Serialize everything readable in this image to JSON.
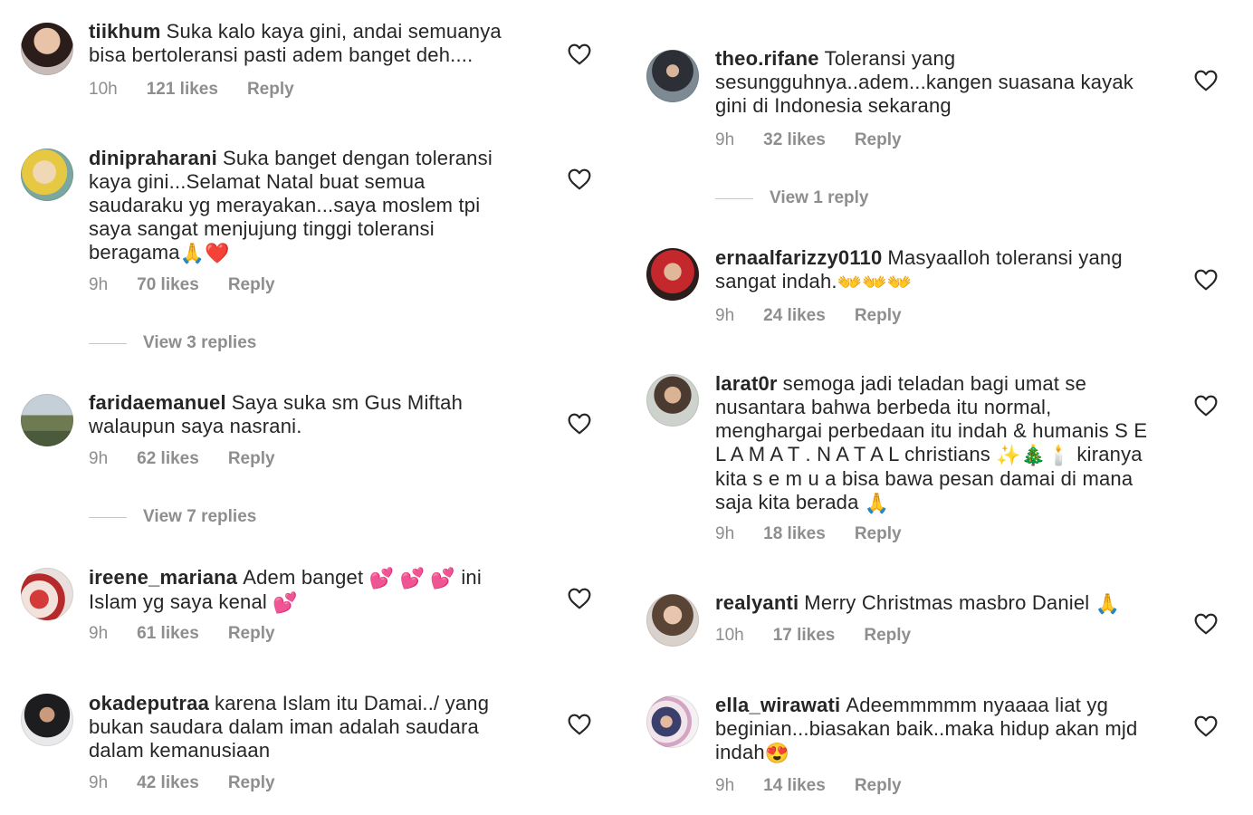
{
  "left": {
    "comments": [
      {
        "username": "tiikhum",
        "text": "Suka kalo kaya gini, andai semuanya bisa bertoleransi pasti adem banget deh....",
        "time": "10h",
        "likes": "121 likes",
        "reply": "Reply"
      },
      {
        "username": "dinipraharani",
        "text": "Suka banget dengan toleransi kaya gini...Selamat Natal buat semua saudaraku yg merayakan...saya moslem tpi saya sangat menjujung tinggi toleransi beragama",
        "emoji": "🙏❤️",
        "time": "9h",
        "likes": "70 likes",
        "reply": "Reply",
        "view_replies": "View 3 replies"
      },
      {
        "username": "faridaemanuel",
        "text": "Saya suka sm Gus Miftah walaupun saya nasrani.",
        "time": "9h",
        "likes": "62 likes",
        "reply": "Reply",
        "view_replies": "View 7 replies"
      },
      {
        "username": "ireene_mariana",
        "text_a": "Adem banget",
        "emoji_a": "💕 💕 💕",
        "text_b": "ini Islam yg saya kenal",
        "emoji_b": "💕",
        "time": "9h",
        "likes": "61 likes",
        "reply": "Reply"
      },
      {
        "username": "okadeputraa",
        "text": "karena Islam itu Damai../ yang bukan saudara dalam iman adalah saudara dalam kemanusiaan",
        "time": "9h",
        "likes": "42 likes",
        "reply": "Reply"
      }
    ]
  },
  "right": {
    "comments": [
      {
        "username": "theo.rifane",
        "text": "Toleransi yang sesungguhnya..adem...kangen suasana kayak gini di Indonesia sekarang",
        "time": "9h",
        "likes": "32 likes",
        "reply": "Reply",
        "view_replies": "View 1 reply"
      },
      {
        "username": "ernaalfarizzy0110",
        "text": "Masyaalloh toleransi yang sangat indah.",
        "emoji": "👐👐👐",
        "time": "9h",
        "likes": "24 likes",
        "reply": "Reply"
      },
      {
        "username": "larat0r",
        "text_a": "semoga jadi teladan bagi umat se nusantara bahwa berbeda itu normal, menghargai perbedaan itu indah & humanis  S E L A M A T . N A T A L  christians",
        "emoji_a": "✨🎄🕯️",
        "text_b": "kiranya kita s e m u a bisa bawa pesan damai di mana saja kita berada",
        "emoji_b": "🙏",
        "time": "9h",
        "likes": "18 likes",
        "reply": "Reply"
      },
      {
        "username": "realyanti",
        "text": "Merry Christmas masbro Daniel",
        "emoji": "🙏",
        "time": "10h",
        "likes": "17 likes",
        "reply": "Reply"
      },
      {
        "username": "ella_wirawati",
        "text": "Adeemmmmm nyaaaa liat yg beginian...biasakan baik..maka hidup akan mjd indah",
        "emoji": "😍",
        "time": "9h",
        "likes": "14 likes",
        "reply": "Reply"
      }
    ]
  },
  "icons": {
    "like": "heart-outline-icon"
  },
  "colors": {
    "text": "#262626",
    "meta": "#8e8e8e",
    "divider": "#c7c7c7"
  }
}
